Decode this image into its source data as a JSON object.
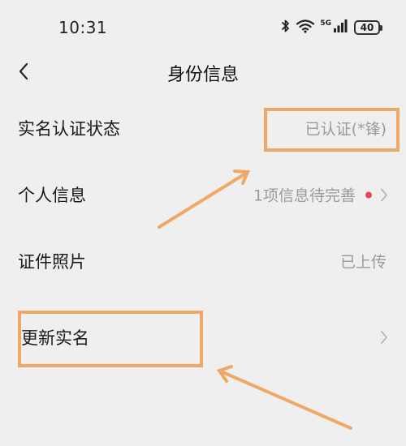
{
  "status_bar": {
    "time": "10:31",
    "network_label": "5G",
    "battery_level": "40",
    "icons": [
      "bluetooth-icon",
      "wifi-icon",
      "signal-icon",
      "battery-icon"
    ]
  },
  "nav": {
    "title": "身份信息",
    "back_icon": "chevron-left-icon"
  },
  "rows": [
    {
      "label": "实名认证状态",
      "value": "已认证(*锋)",
      "has_chevron": false,
      "has_red_dot": false
    },
    {
      "label": "个人信息",
      "value": "1项信息待完善",
      "has_chevron": true,
      "has_red_dot": true
    },
    {
      "label": "证件照片",
      "value": "已上传",
      "has_chevron": false,
      "has_red_dot": false
    },
    {
      "label": "更新实名",
      "value": "",
      "has_chevron": true,
      "has_red_dot": false
    }
  ],
  "colors": {
    "background": "#efefef",
    "annotation": "#f0a866",
    "red_dot": "#e24a5a",
    "value_text": "#9a9a9a",
    "chevron": "#b8b8b8"
  }
}
